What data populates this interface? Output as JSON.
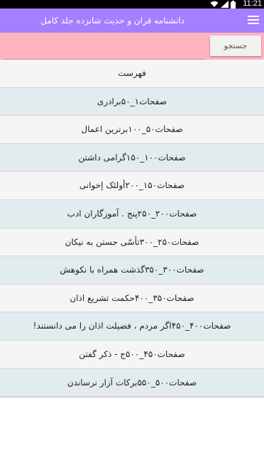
{
  "status_bar": {
    "time": "11:21"
  },
  "app_bar": {
    "title": "دانشنامه قران و حدیث شانزده جلد کامل",
    "menu_icon": "hamburger-menu-icon",
    "color": "#a47fff"
  },
  "search": {
    "value": "",
    "button_label": "جستجو",
    "background": "#ffb3bd"
  },
  "list": {
    "items": [
      "فهرست",
      "صفحات۱_۵۰برادری",
      "صفحات۵۰_۱۰۰برترین اعمال",
      "صفحات۱۰۰_۱۵۰گرامی داشتن",
      "صفحات۱۵۰_۲۰۰أولئک إخوانی",
      "صفحات۲۰۰_۲۵۰پنج . آموزگاران ادب",
      "صفحات۲۵۰_۳۰۰تأسّی جستن به نیکان",
      "صفحات۳۰۰_۳۵۰گذشت همراه با نکوهش",
      "صفحات۳۵۰_۴۰۰حکمت تشریع اذان",
      "صفحات۴۰۰_۴۵۰اگر مردم ، فضیلت اذان را می دانستند!",
      "صفحات۴۵۰_۵۰۰ج - ذکر گفتن",
      "صفحات۵۰۰_۵۵۰برکات آزار نرساندن"
    ]
  }
}
